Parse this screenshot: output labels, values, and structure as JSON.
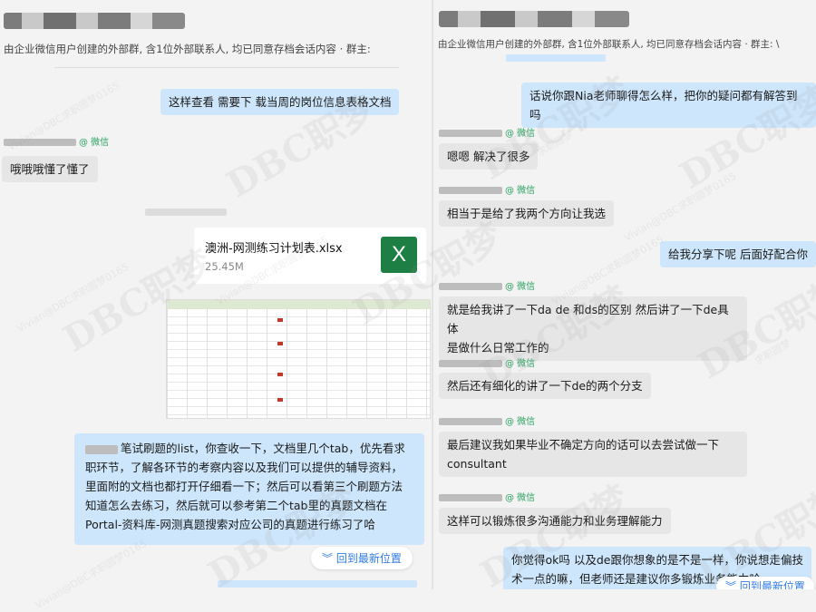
{
  "left": {
    "subtitle": "由企业微信用户创建的外部群, 含1位外部联系人, 均已同意存档会话内容 · 群主:",
    "messages": {
      "m1": "这样查看 需要下 载当周的岗位信息表格文档",
      "sender1": "@ 微信",
      "m2": "哦哦哦懂了懂了",
      "m3": "笔试刷题的list，你查收一下，文档里几个tab，优先看求职环节，了解各环节的考察内容以及我们可以提供的辅导资料，里面附的文档也都打开仔细看一下；然后可以看第三个刷题方法知道怎么去练习，然后就可以参考第二个tab里的真题文档在Portal-资料库-网测真题搜索对应公司的真题进行练习了哈"
    },
    "file": {
      "name": "澳洲-网测练习计划表.xlsx",
      "size": "25.45M",
      "icon_letter": "X"
    },
    "back_button": "回到最新位置"
  },
  "right": {
    "subtitle": "由企业微信用户创建的外部群, 含1位外部联系人, 均已同意存档会话内容 · 群主: \\",
    "messages": {
      "m1": "话说你跟Nia老师聊得怎么样，把你的疑问都有解答到吗",
      "sender": "@ 微信",
      "m2": "嗯嗯 解决了很多",
      "m3": "相当于是给了我两个方向让我选",
      "m4": "给我分享下呢 后面好配合你",
      "m5a": "就是给我讲了一下da de 和ds的区别 然后讲了一下de具体",
      "m5b": "是做什么日常工作的",
      "m6": "然后还有细化的讲了一下de的两个分支",
      "m7a": "最后建议我如果毕业不确定方向的话可以去尝试做一下",
      "m7b": "consultant",
      "m8": "这样可以锻炼很多沟通能力和业务理解能力",
      "m9a": "你觉得ok吗 以及de跟你想象的是不是一样，你说想走偏技",
      "m9b": "术一点的嘛，但老师还是建议你多锻炼业务能力哈"
    },
    "back_button": "回到最新位置"
  },
  "watermarks": {
    "brand": "DBC职梦",
    "small": "Vivian@DBC求职圆梦0165",
    "seal": "求职圆梦"
  },
  "colors": {
    "outgoing_bubble": "#cde6fb",
    "incoming_bubble": "#e6e6e6",
    "link": "#2f7be5",
    "sender": "#2aa35f",
    "excel": "#1e7f45"
  }
}
